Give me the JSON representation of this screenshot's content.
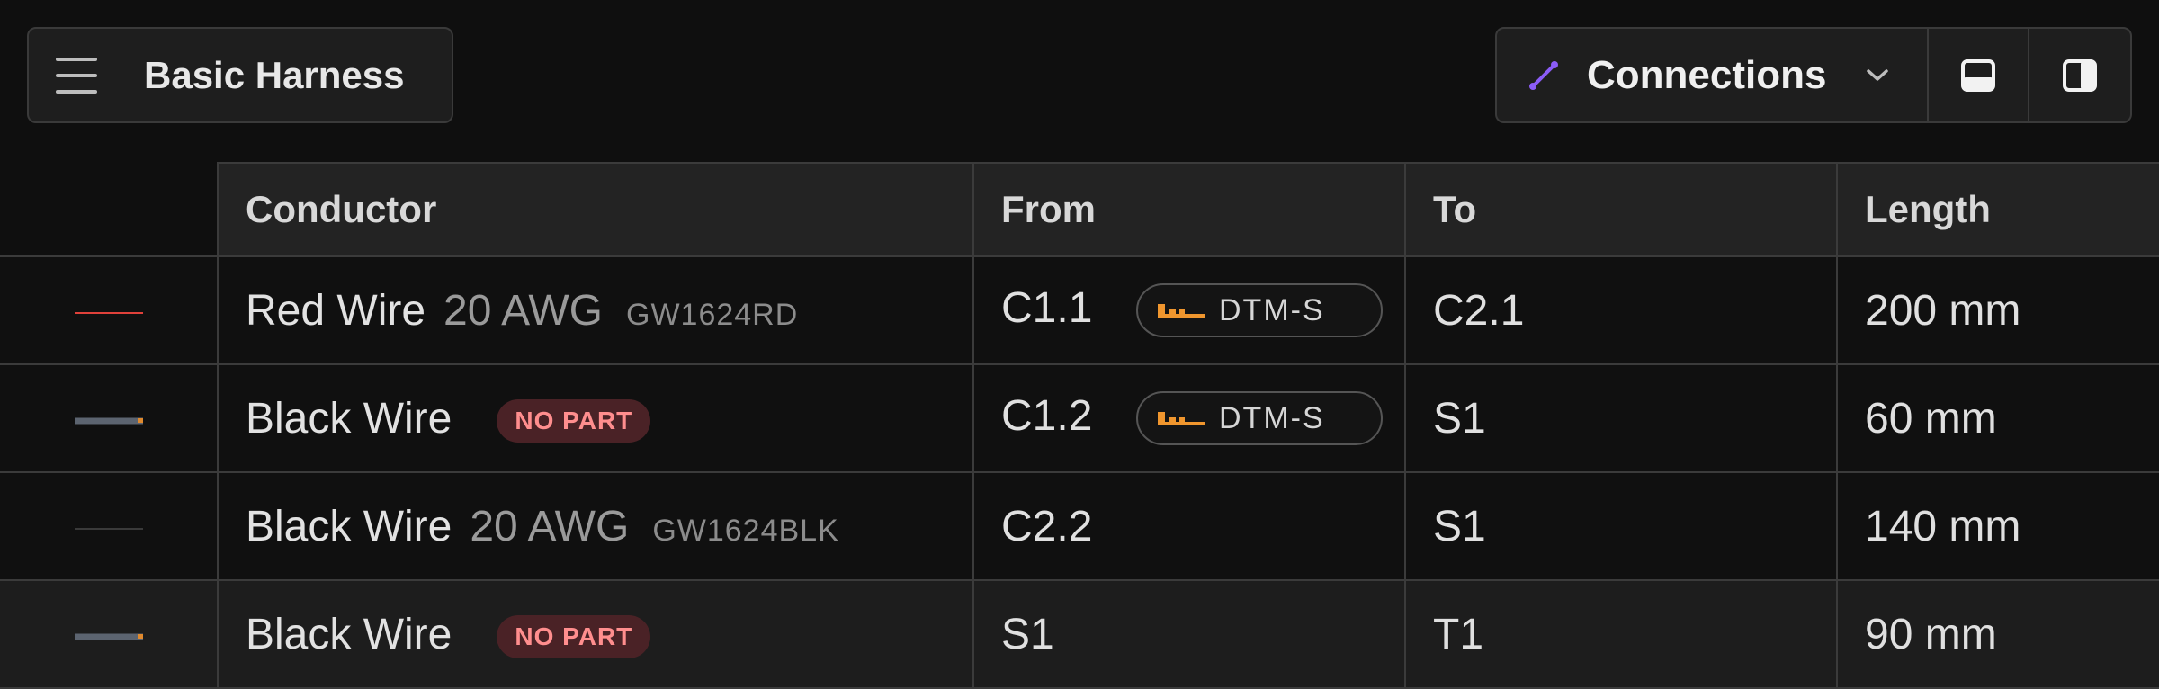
{
  "app": {
    "file_name": "Basic Harness"
  },
  "view": {
    "current": "Connections"
  },
  "icons": {
    "menu": "hamburger-icon",
    "connections": "connection-line-icon",
    "chevron": "chevron-down-icon",
    "layout_bottom": "panel-bottom-icon",
    "layout_right": "panel-right-icon",
    "connector": "connector-shape-icon"
  },
  "colors": {
    "accent": "#8b5cf6",
    "connector_icon": "#f0962e",
    "no_part_bg": "#4a2226",
    "no_part_text": "#ff8e8e"
  },
  "table": {
    "columns": [
      "Conductor",
      "From",
      "To",
      "Length"
    ],
    "rows": [
      {
        "wire_color": "#e0413a",
        "name": "Red Wire",
        "gauge": "20 AWG",
        "part_number": "GW1624RD",
        "no_part": "",
        "from_pin": "C1.1",
        "from_connector": "DTM-S",
        "to": "C2.1",
        "length": "200 mm"
      },
      {
        "wire_color": "#5c6470",
        "name": "Black Wire",
        "gauge": "",
        "part_number": "",
        "no_part": "NO PART",
        "from_pin": "C1.2",
        "from_connector": "DTM-S",
        "to": "S1",
        "length": "60 mm"
      },
      {
        "wire_color": "#3a3a3a",
        "name": "Black Wire",
        "gauge": "20 AWG",
        "part_number": "GW1624BLK",
        "no_part": "",
        "from_pin": "C2.2",
        "from_connector": "",
        "to": "S1",
        "length": "140 mm"
      },
      {
        "wire_color": "#5c6470",
        "name": "Black Wire",
        "gauge": "",
        "part_number": "",
        "no_part": "NO PART",
        "from_pin": "S1",
        "from_connector": "",
        "to": "T1",
        "length": "90 mm"
      }
    ]
  }
}
